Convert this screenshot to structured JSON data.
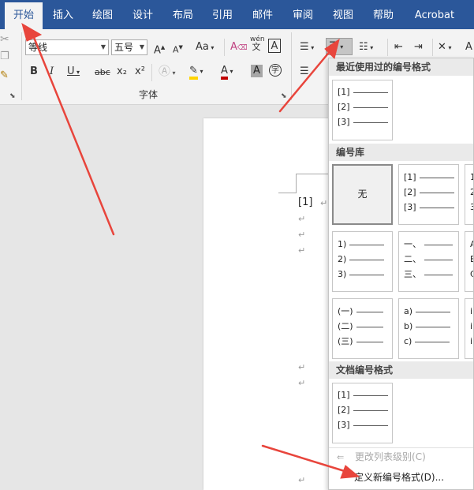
{
  "tabs": [
    "开始",
    "插入",
    "绘图",
    "设计",
    "布局",
    "引用",
    "邮件",
    "审阅",
    "视图",
    "帮助",
    "Acrobat"
  ],
  "font": {
    "name": "等线",
    "size": "五号",
    "group_label": "字体"
  },
  "ribbon_glyphs": {
    "aa": "Aa",
    "wen": "wén",
    "wen2": "文",
    "A_box": "A",
    "bold": "B",
    "italic": "I",
    "underline": "U",
    "strike": "abc",
    "sub": "x₂",
    "sup": "x²",
    "A_font": "A",
    "zi": "字"
  },
  "dropdown": {
    "recent_header": "最近使用过的编号格式",
    "library_header": "编号库",
    "doc_header": "文档编号格式",
    "none_label": "无",
    "recent_rows": [
      "[1]",
      "[2]",
      "[3]"
    ],
    "lib_tiles": [
      [
        "[1]",
        "[2]",
        "[3]"
      ],
      [
        "1",
        "2",
        "3"
      ],
      [
        "1)",
        "2)",
        "3)"
      ],
      [
        "一、",
        "二、",
        "三、"
      ],
      [
        "A",
        "B",
        "C"
      ],
      [
        "(一)",
        "(二)",
        "(三)"
      ],
      [
        "a)",
        "b)",
        "c)"
      ],
      [
        "i",
        "i",
        "i"
      ]
    ],
    "doc_rows": [
      "[1]",
      "[2]",
      "[3]"
    ],
    "change_level": "更改列表级别(C)",
    "define_new": "定义新编号格式(D)..."
  },
  "doc": {
    "list_label": "[1]",
    "para_mark": "↵"
  },
  "colors": {
    "brand": "#2b579a",
    "arrow": "#e8453c",
    "highlight": "#ffd400",
    "font_red": "#c00000"
  }
}
